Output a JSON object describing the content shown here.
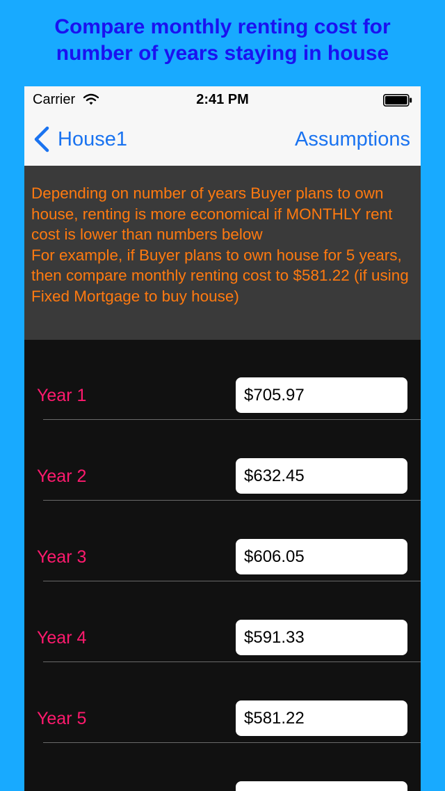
{
  "banner": {
    "title": "Compare monthly renting cost for number of years staying in house"
  },
  "status_bar": {
    "carrier": "Carrier",
    "time": "2:41 PM"
  },
  "nav": {
    "back_label": "House1",
    "right_label": "Assumptions"
  },
  "info": {
    "text": "Depending on number of years Buyer plans to own house, renting is more economical if MONTHLY rent cost is lower than numbers below\nFor example, if Buyer plans to own house for 5 years, then compare monthly renting cost to $581.22 (if using Fixed Mortgage to buy house)"
  },
  "rows": [
    {
      "label": "Year 1",
      "value": "$705.97"
    },
    {
      "label": "Year 2",
      "value": "$632.45"
    },
    {
      "label": "Year 3",
      "value": "$606.05"
    },
    {
      "label": "Year 4",
      "value": "$591.33"
    },
    {
      "label": "Year 5",
      "value": "$581.22"
    },
    {
      "label": "",
      "value": ""
    }
  ],
  "colors": {
    "background": "#18aaff",
    "banner_text": "#1a12f0",
    "accent_blue": "#1a73f0",
    "info_text": "#ff7a10",
    "row_label": "#ff1a6e"
  }
}
